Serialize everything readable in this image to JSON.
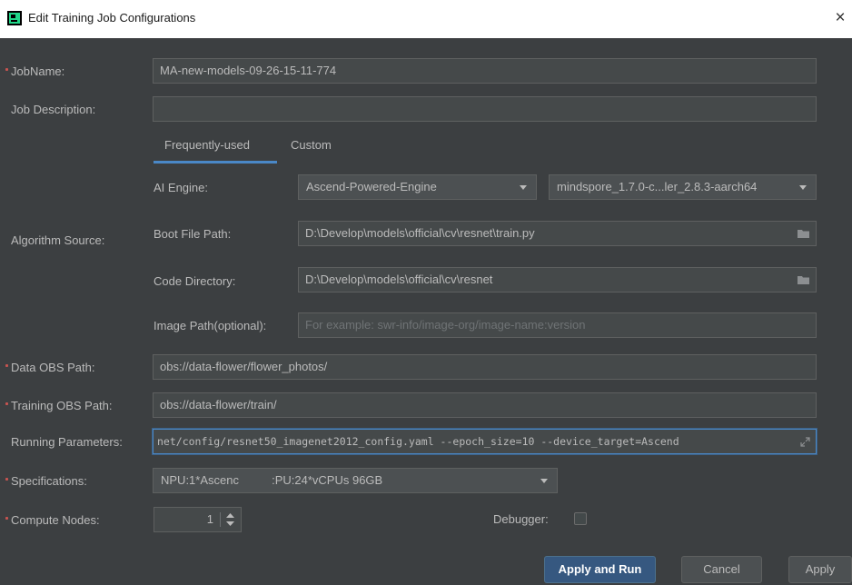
{
  "window": {
    "title": "Edit Training Job Configurations",
    "close_glyph": "×",
    "icon": "app-logo-icon"
  },
  "job_name": {
    "label": "JobName:",
    "value": "MA-new-models-09-26-15-11-774"
  },
  "job_description": {
    "label": "Job Description:",
    "value": ""
  },
  "tabs": [
    {
      "label": "Frequently-used",
      "active": true
    },
    {
      "label": "Custom",
      "active": false
    }
  ],
  "algorithm_source": {
    "label": "Algorithm Source:",
    "ai_engine": {
      "label": "AI Engine:",
      "engine": "Ascend-Powered-Engine",
      "version": "mindspore_1.7.0-c...ler_2.8.3-aarch64"
    },
    "boot_file": {
      "label": "Boot File Path:",
      "value": "D:\\Develop\\models\\official\\cv\\resnet\\train.py"
    },
    "code_dir": {
      "label": "Code Directory:",
      "value": "D:\\Develop\\models\\official\\cv\\resnet"
    },
    "image_path": {
      "label": "Image Path(optional):",
      "placeholder": "For example: swr-info/image-org/image-name:version"
    }
  },
  "data_obs": {
    "label": "Data OBS Path:",
    "value": "obs://data-flower/flower_photos/"
  },
  "training_obs": {
    "label": "Training OBS Path:",
    "value": "obs://data-flower/train/"
  },
  "running_params": {
    "label": "Running Parameters:",
    "value": "net/config/resnet50_imagenet2012_config.yaml --epoch_size=10 --device_target=Ascend"
  },
  "specifications": {
    "label": "Specifications:",
    "value": "NPU:1*Ascenc          :PU:24*vCPUs 96GB"
  },
  "compute_nodes": {
    "label": "Compute Nodes:",
    "value": "1"
  },
  "debugger": {
    "label": "Debugger:",
    "checked": false
  },
  "buttons": {
    "apply_run": "Apply and Run",
    "cancel": "Cancel",
    "apply": "Apply"
  },
  "colors": {
    "background": "#3c3f41",
    "field": "#45494a",
    "accent": "#4a88c7",
    "primary_button": "#365880",
    "required_marker": "#c75450"
  }
}
